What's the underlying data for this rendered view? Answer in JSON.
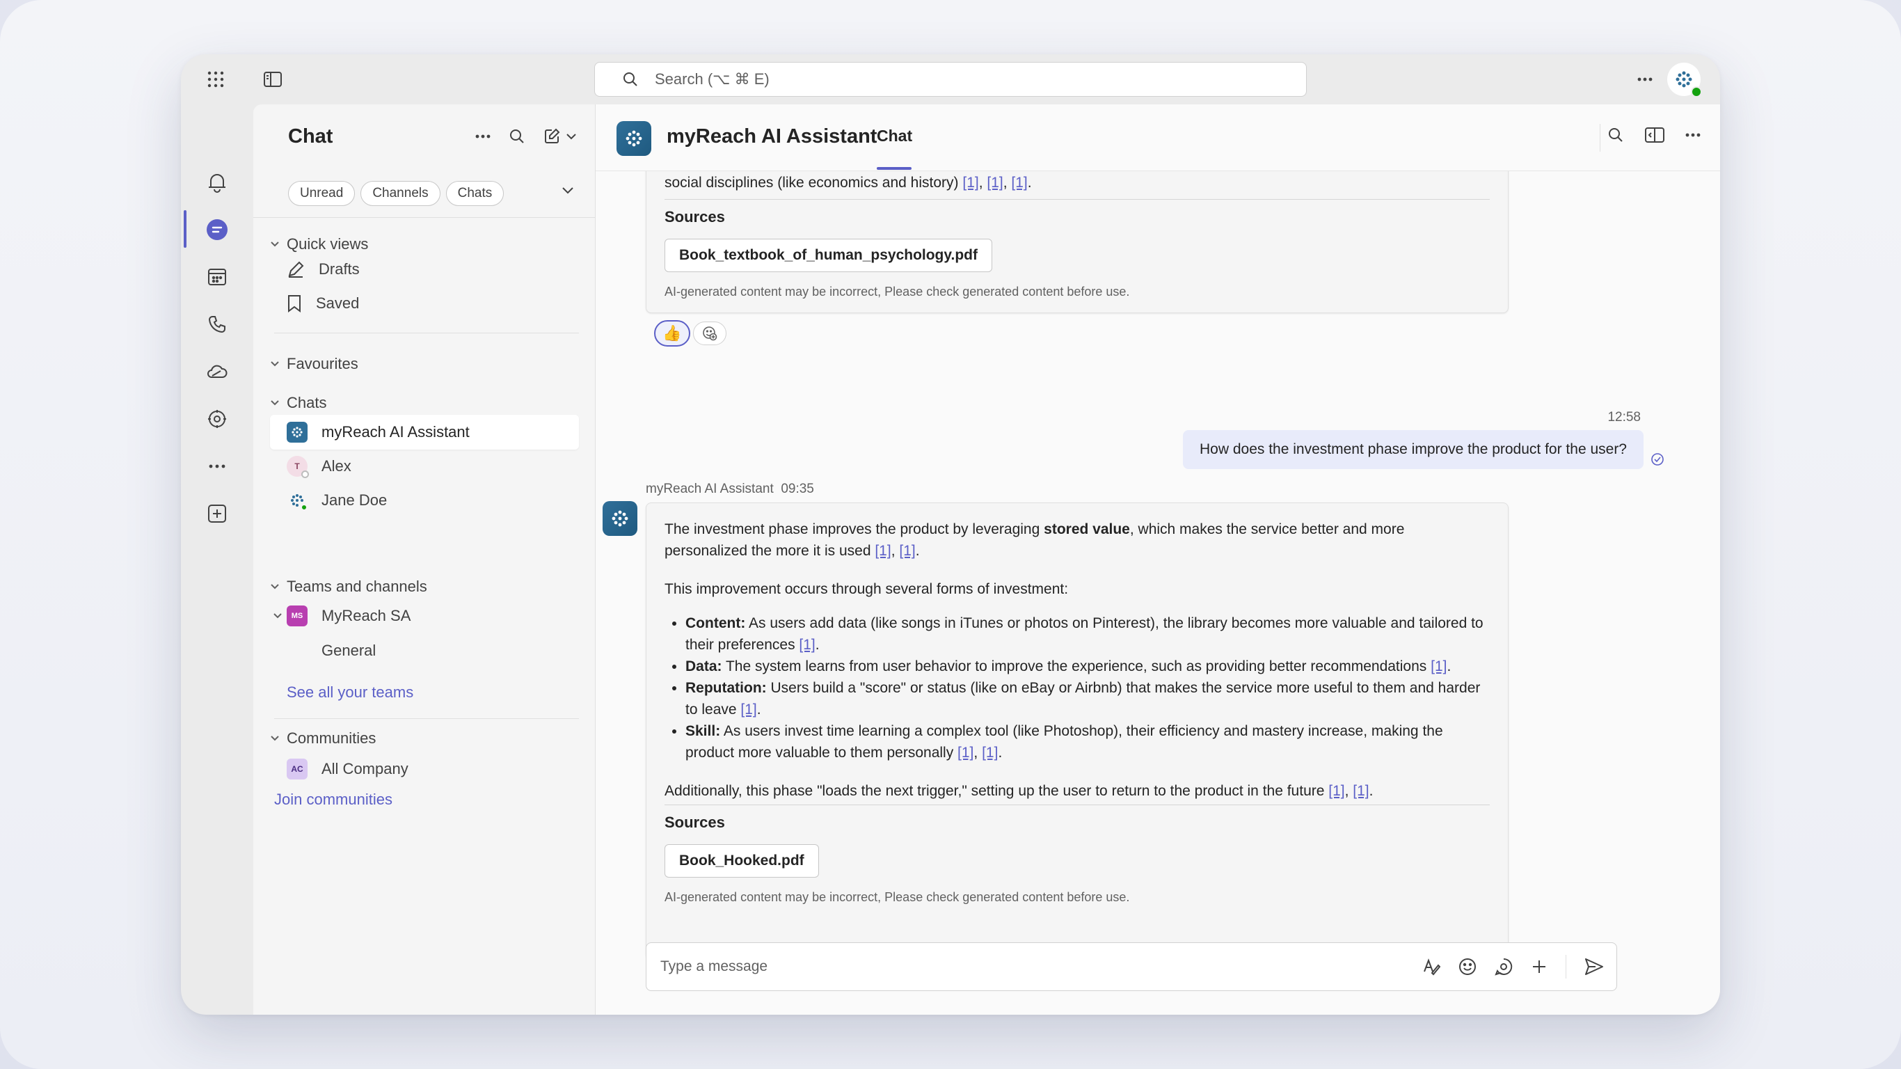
{
  "search": {
    "placeholder": "Search (⌥ ⌘ E)"
  },
  "sidebar": {
    "title": "Chat",
    "filters": [
      "Unread",
      "Channels",
      "Chats"
    ],
    "quick_views": {
      "label": "Quick views",
      "items": [
        "Drafts",
        "Saved"
      ]
    },
    "favourites": {
      "label": "Favourites"
    },
    "chats": {
      "label": "Chats",
      "items": [
        {
          "name": "myReach AI Assistant",
          "active": true
        },
        {
          "name": "Alex",
          "initial": "T"
        },
        {
          "name": "Jane Doe"
        }
      ]
    },
    "teams": {
      "label": "Teams and channels",
      "team": {
        "name": "MyReach SA",
        "initials": "MS"
      },
      "channel": "General",
      "see_all": "See all your teams"
    },
    "communities": {
      "label": "Communities",
      "items": [
        {
          "name": "All Company",
          "initials": "AC"
        }
      ],
      "join": "Join communities"
    }
  },
  "header": {
    "title": "myReach AI Assistant",
    "tab": "Chat"
  },
  "messages": {
    "first": {
      "tail_text": "social disciplines (like economics and history)",
      "cites": [
        "[1]",
        "[1]",
        "[1]"
      ],
      "sources_label": "Sources",
      "source_file": "Book_textbook_of_human_psychology.pdf",
      "disclaimer": "AI-generated content may be incorrect, Please check generated content before use."
    },
    "user": {
      "time": "12:58",
      "text": "How does the investment phase improve the product for the user?"
    },
    "reply": {
      "sender": "myReach AI Assistant",
      "time": "09:35",
      "intro_a": "The investment phase improves the product by leveraging ",
      "intro_bold": "stored value",
      "intro_b": ", which makes the service better and more personalized the more it is used ",
      "para2": "This improvement occurs through several forms of investment:",
      "bullets": [
        {
          "term": "Content:",
          "text": " As users add data (like songs in iTunes or photos on Pinterest), the library becomes more valuable and tailored to their preferences "
        },
        {
          "term": "Data:",
          "text": " The system learns from user behavior to improve the experience, such as providing better recommendations "
        },
        {
          "term": "Reputation:",
          "text": " Users build a \"score\" or status (like on eBay or Airbnb) that makes the service more useful to them and harder to leave "
        },
        {
          "term": "Skill:",
          "text": " As users invest time learning a complex tool (like Photoshop), their efficiency and mastery increase, making the product more valuable to them personally "
        }
      ],
      "closing": "Additionally, this phase \"loads the next trigger,\" setting up the user to return to the product in the future ",
      "cite": "[1]",
      "sources_label": "Sources",
      "source_file": "Book_Hooked.pdf",
      "disclaimer": "AI-generated content may be incorrect, Please check generated content before use."
    }
  },
  "composer": {
    "placeholder": "Type a message"
  },
  "colors": {
    "accent": "#5b5fc7",
    "bot_tile": "#2f6f99",
    "presence": "#13a10e"
  }
}
